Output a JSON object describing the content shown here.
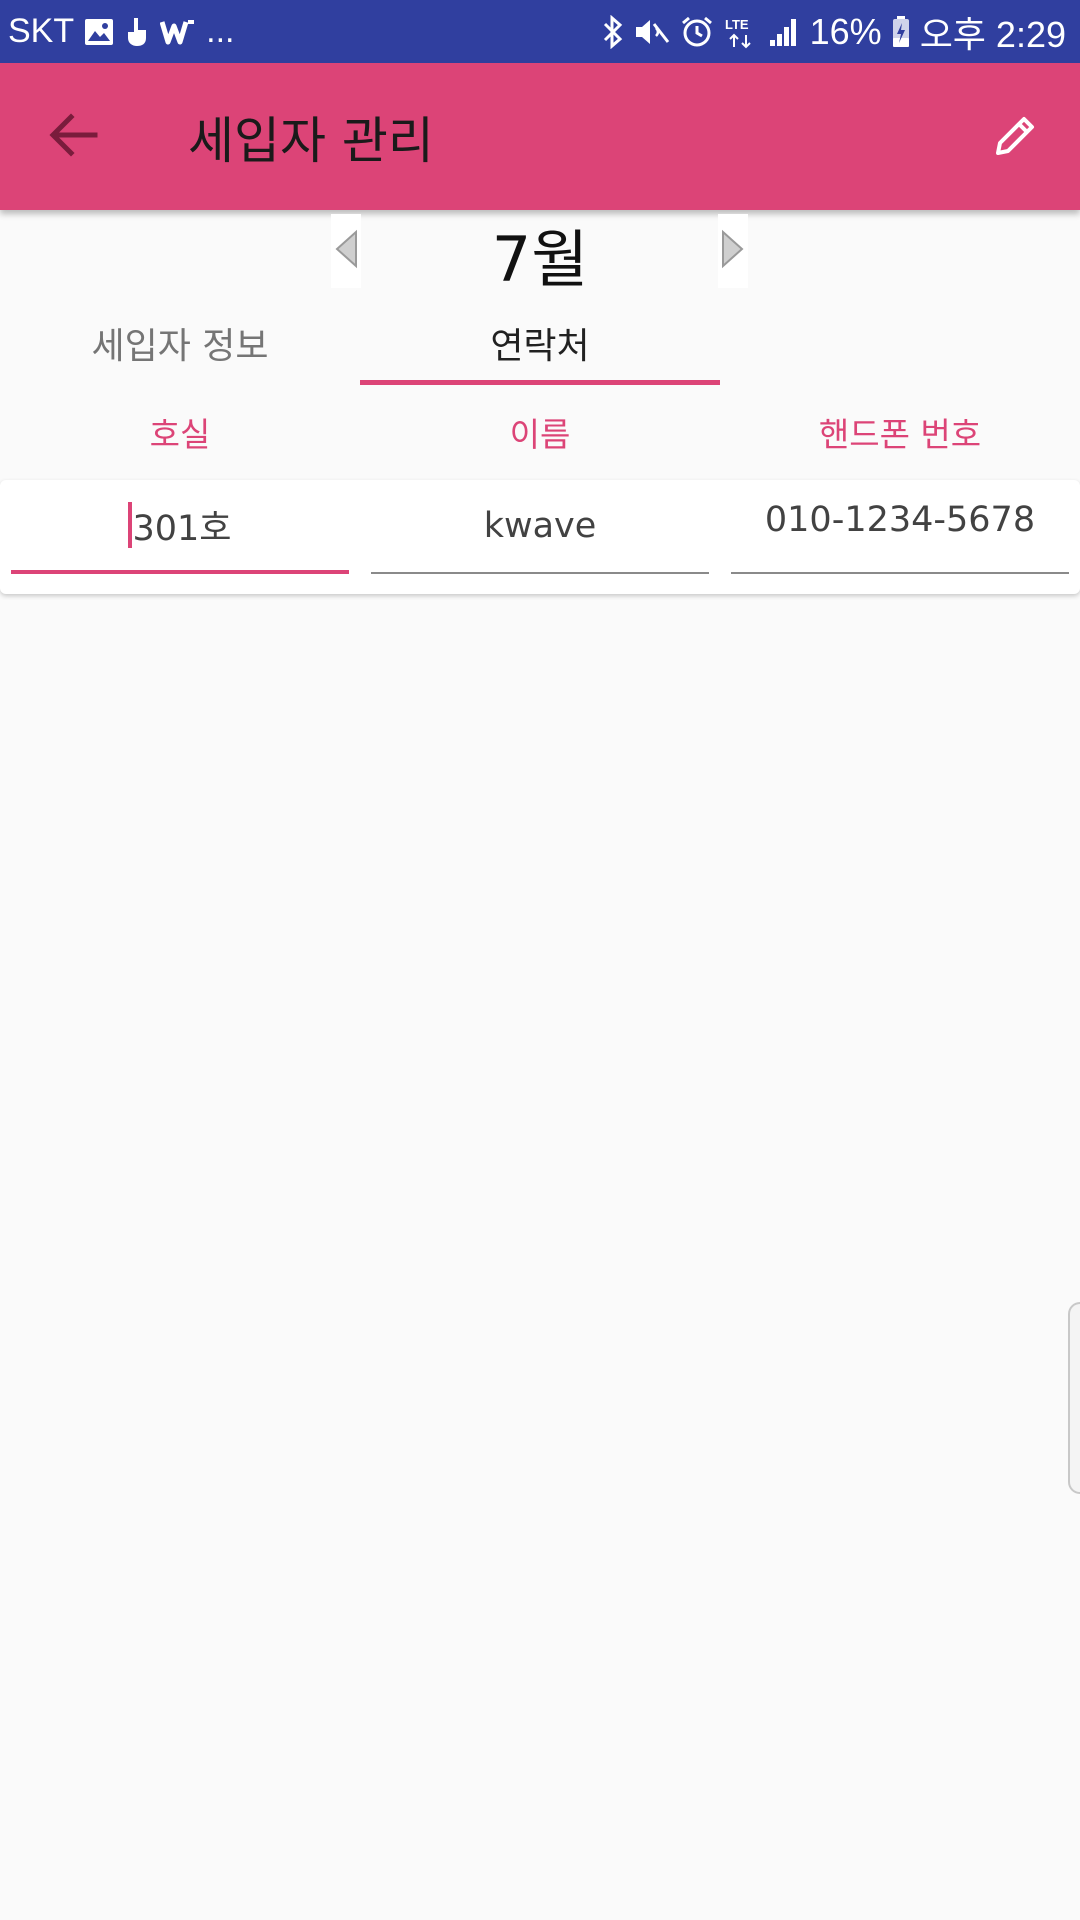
{
  "status_bar": {
    "carrier": "SKT",
    "more": "...",
    "network": "LTE",
    "battery": "16%",
    "time": "오후 2:29",
    "icons": [
      "gallery-icon",
      "hand-icon",
      "w-app-icon",
      "bluetooth-icon",
      "mute-icon",
      "alarm-icon",
      "lte-icon",
      "signal-icon",
      "battery-icon"
    ]
  },
  "app_bar": {
    "title": "세입자 관리",
    "back_icon": "arrow-left-icon",
    "edit_icon": "pencil-icon"
  },
  "month": {
    "label": "7월"
  },
  "tabs": [
    {
      "label": "세입자 정보",
      "selected": false
    },
    {
      "label": "연락처",
      "selected": true
    }
  ],
  "columns": [
    {
      "label": "호실"
    },
    {
      "label": "이름"
    },
    {
      "label": "핸드폰 번호"
    }
  ],
  "row": {
    "room": "301호",
    "name": "kwave",
    "phone": "010-1234-5678"
  },
  "colors": {
    "status_bar": "#303f9f",
    "accent": "#dc4477",
    "background": "#fafafa"
  }
}
